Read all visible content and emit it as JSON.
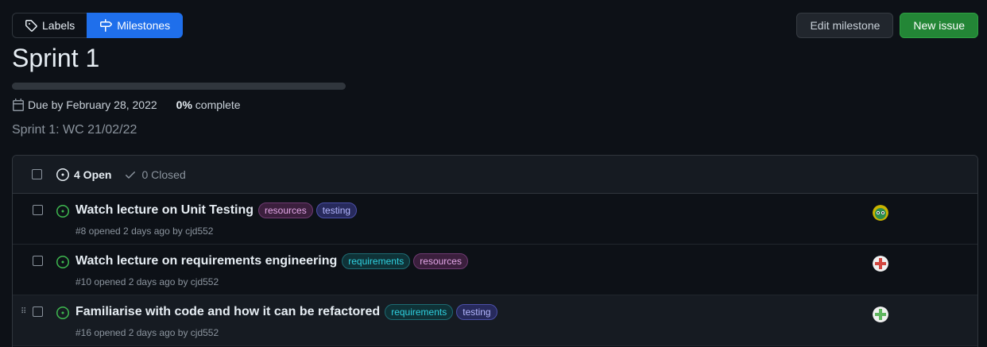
{
  "nav": {
    "labels": "Labels",
    "milestones": "Milestones"
  },
  "actions": {
    "edit": "Edit milestone",
    "new_issue": "New issue"
  },
  "milestone": {
    "title": "Sprint 1",
    "progress_percent": 0,
    "due": "Due by February 28, 2022",
    "percent_text": "0%",
    "complete_text": "complete",
    "description": "Sprint 1: WC 21/02/22"
  },
  "issues_header": {
    "open": "4 Open",
    "closed": "0 Closed"
  },
  "colors": {
    "accent": "#1f6feb",
    "primary_button": "#238636",
    "open_icon": "#3fb950",
    "label_resources_fg": "#e4a7e8",
    "label_testing_fg": "#b4b7ff",
    "label_requirements_fg": "#2fd1e0"
  },
  "issues": [
    {
      "title": "Watch lecture on Unit Testing",
      "labels": [
        {
          "name": "resources",
          "kind": "resources"
        },
        {
          "name": "testing",
          "kind": "testing"
        }
      ],
      "meta": "#8 opened 2 days ago by cjd552",
      "avatar": "avatar-green-face"
    },
    {
      "title": "Watch lecture on requirements engineering",
      "labels": [
        {
          "name": "requirements",
          "kind": "requirements"
        },
        {
          "name": "resources",
          "kind": "resources"
        }
      ],
      "meta": "#10 opened 2 days ago by cjd552",
      "avatar": "avatar-red-cross"
    },
    {
      "title": "Familiarise with code and how it can be refactored",
      "labels": [
        {
          "name": "requirements",
          "kind": "requirements"
        },
        {
          "name": "testing",
          "kind": "testing"
        }
      ],
      "meta": "#16 opened 2 days ago by cjd552",
      "avatar": "avatar-green-cross"
    }
  ]
}
